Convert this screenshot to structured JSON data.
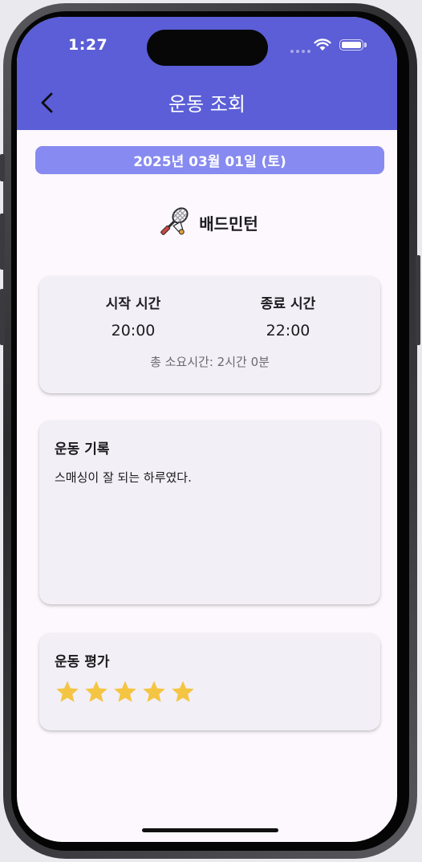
{
  "status_bar": {
    "time": "1:27"
  },
  "app_bar": {
    "title": "운동 조회",
    "back_icon": "chevron-left-icon"
  },
  "date_label": "2025년 03월 01일 (토)",
  "sport": {
    "name": "배드민턴",
    "icon": "badminton-racket-icon"
  },
  "time_card": {
    "start_label": "시작 시간",
    "start_value": "20:00",
    "end_label": "종료 시간",
    "end_value": "22:00",
    "duration": "총 소요시간: 2시간 0분"
  },
  "record_card": {
    "title": "운동 기록",
    "text": "스매싱이 잘 되는 하루였다."
  },
  "rating_card": {
    "title": "운동 평가",
    "rating": 5,
    "max_rating": 5
  },
  "colors": {
    "app_bar": "#5b5ed6",
    "date_pill": "#878af0",
    "star": "#f4c542",
    "card": "#f2eff6",
    "background": "#fcf8fd"
  }
}
